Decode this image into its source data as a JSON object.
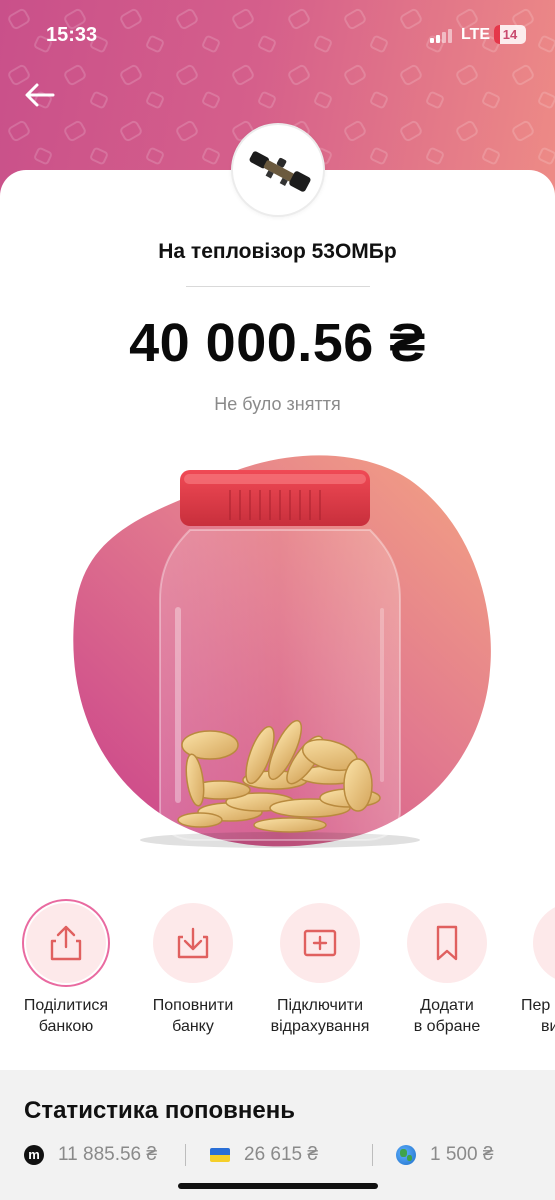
{
  "status_bar": {
    "time": "15:33",
    "network": "LTE",
    "battery": "14"
  },
  "jar": {
    "title": "На тепловізор 53ОМБр",
    "amount": "40 000.56 ₴",
    "withdraw_note": "Не було зняття"
  },
  "actions": [
    {
      "label_line1": "Поділитися",
      "label_line2": "банкою"
    },
    {
      "label_line1": "Поповнити",
      "label_line2": "банку"
    },
    {
      "label_line1": "Підключити",
      "label_line2": "відрахування"
    },
    {
      "label_line1": "Додати",
      "label_line2": "в обране"
    },
    {
      "label_line1": "Пер",
      "label_line2": "ви"
    }
  ],
  "stats": {
    "title": "Статистика поповнень",
    "items": [
      {
        "icon": "monobank-icon",
        "value": "11 885.56 ₴"
      },
      {
        "icon": "ukraine-flag-icon",
        "value": "26 615 ₴"
      },
      {
        "icon": "globe-icon",
        "value": "1 500 ₴"
      }
    ]
  },
  "colors": {
    "header_start": "#c9508a",
    "header_end": "#ee8c86",
    "action_bg": "#fde9ea",
    "action_icon": "#e0605f"
  }
}
